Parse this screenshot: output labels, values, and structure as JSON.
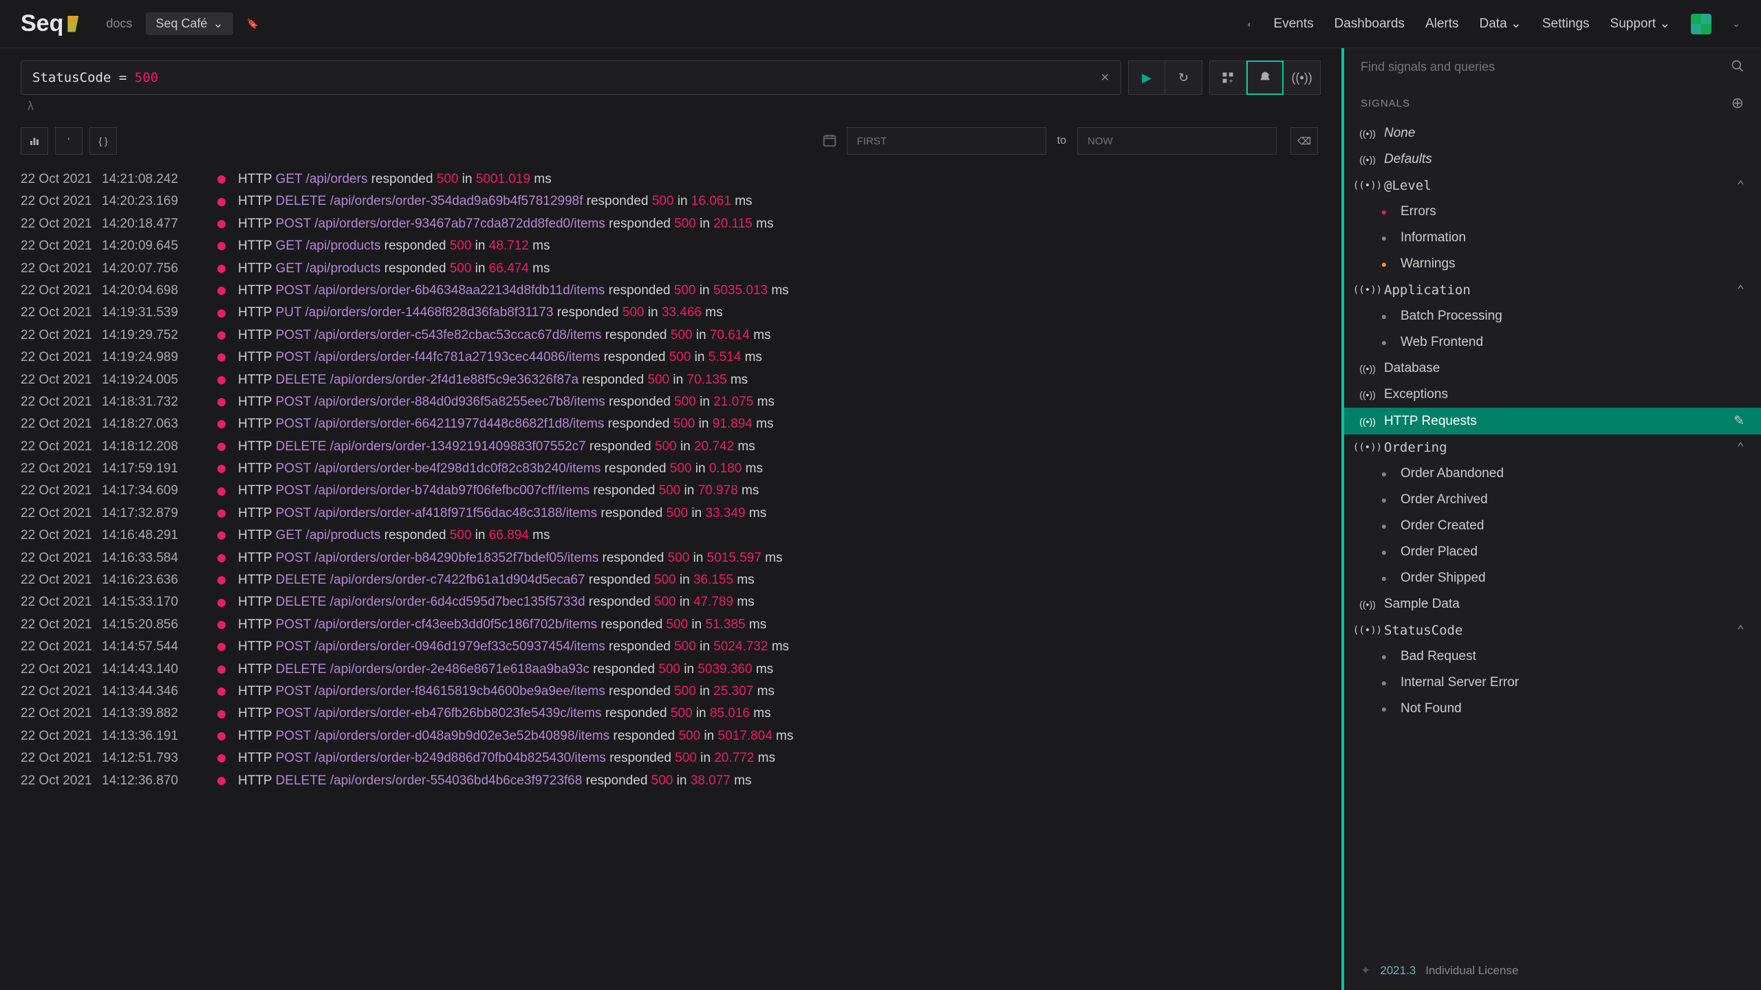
{
  "navbar": {
    "logo": "Seq",
    "docs": "docs",
    "workspace": "Seq Café",
    "right": [
      "Events",
      "Dashboards",
      "Alerts",
      "Data",
      "Settings",
      "Support"
    ]
  },
  "search": {
    "query_field": "StatusCode",
    "query_op": "=",
    "query_val": "500",
    "lambda": "λ"
  },
  "toolbar": {
    "from_placeholder": "FIRST",
    "to_label": "to",
    "to_placeholder": "NOW"
  },
  "sidebar": {
    "search_placeholder": "Find signals and queries",
    "header": "SIGNALS",
    "items": [
      {
        "type": "signal",
        "label": "None",
        "italic": true
      },
      {
        "type": "signal",
        "label": "Defaults",
        "italic": true
      },
      {
        "type": "signal",
        "label": "@Level",
        "mono": true,
        "expandable": true
      },
      {
        "type": "sub",
        "label": "Errors",
        "dot": "err"
      },
      {
        "type": "sub",
        "label": "Information",
        "dot": "info"
      },
      {
        "type": "sub",
        "label": "Warnings",
        "dot": "warn"
      },
      {
        "type": "signal",
        "label": "Application",
        "mono": true,
        "expandable": true
      },
      {
        "type": "sub",
        "label": "Batch Processing",
        "dot": "info"
      },
      {
        "type": "sub",
        "label": "Web Frontend",
        "dot": "info"
      },
      {
        "type": "signal",
        "label": "Database"
      },
      {
        "type": "signal",
        "label": "Exceptions"
      },
      {
        "type": "signal",
        "label": "HTTP Requests",
        "selected": true
      },
      {
        "type": "signal",
        "label": "Ordering",
        "mono": true,
        "expandable": true
      },
      {
        "type": "sub",
        "label": "Order Abandoned",
        "dot": "info"
      },
      {
        "type": "sub",
        "label": "Order Archived",
        "dot": "info"
      },
      {
        "type": "sub",
        "label": "Order Created",
        "dot": "info"
      },
      {
        "type": "sub",
        "label": "Order Placed",
        "dot": "info"
      },
      {
        "type": "sub",
        "label": "Order Shipped",
        "dot": "info"
      },
      {
        "type": "signal",
        "label": "Sample Data"
      },
      {
        "type": "signal",
        "label": "StatusCode",
        "mono": true,
        "expandable": true
      },
      {
        "type": "sub",
        "label": "Bad Request",
        "dot": "info"
      },
      {
        "type": "sub",
        "label": "Internal Server Error",
        "dot": "info"
      },
      {
        "type": "sub",
        "label": "Not Found",
        "dot": "info"
      }
    ],
    "footer": {
      "version": "2021.3",
      "license": "Individual License"
    }
  },
  "events": [
    {
      "date": "22 Oct 2021",
      "time": "14:21:08.242",
      "method": "GET",
      "path": "/api/orders",
      "code": "500",
      "dur": "5001.019"
    },
    {
      "date": "22 Oct 2021",
      "time": "14:20:23.169",
      "method": "DELETE",
      "path": "/api/orders/order-354dad9a69b4f57812998f",
      "code": "500",
      "dur": "16.061"
    },
    {
      "date": "22 Oct 2021",
      "time": "14:20:18.477",
      "method": "POST",
      "path": "/api/orders/order-93467ab77cda872dd8fed0/items",
      "code": "500",
      "dur": "20.115"
    },
    {
      "date": "22 Oct 2021",
      "time": "14:20:09.645",
      "method": "GET",
      "path": "/api/products",
      "code": "500",
      "dur": "48.712"
    },
    {
      "date": "22 Oct 2021",
      "time": "14:20:07.756",
      "method": "GET",
      "path": "/api/products",
      "code": "500",
      "dur": "66.474"
    },
    {
      "date": "22 Oct 2021",
      "time": "14:20:04.698",
      "method": "POST",
      "path": "/api/orders/order-6b46348aa22134d8fdb11d/items",
      "code": "500",
      "dur": "5035.013"
    },
    {
      "date": "22 Oct 2021",
      "time": "14:19:31.539",
      "method": "PUT",
      "path": "/api/orders/order-14468f828d36fab8f31173",
      "code": "500",
      "dur": "33.466"
    },
    {
      "date": "22 Oct 2021",
      "time": "14:19:29.752",
      "method": "POST",
      "path": "/api/orders/order-c543fe82cbac53ccac67d8/items",
      "code": "500",
      "dur": "70.614"
    },
    {
      "date": "22 Oct 2021",
      "time": "14:19:24.989",
      "method": "POST",
      "path": "/api/orders/order-f44fc781a27193cec44086/items",
      "code": "500",
      "dur": "5.514"
    },
    {
      "date": "22 Oct 2021",
      "time": "14:19:24.005",
      "method": "DELETE",
      "path": "/api/orders/order-2f4d1e88f5c9e36326f87a",
      "code": "500",
      "dur": "70.135"
    },
    {
      "date": "22 Oct 2021",
      "time": "14:18:31.732",
      "method": "POST",
      "path": "/api/orders/order-884d0d936f5a8255eec7b8/items",
      "code": "500",
      "dur": "21.075"
    },
    {
      "date": "22 Oct 2021",
      "time": "14:18:27.063",
      "method": "POST",
      "path": "/api/orders/order-664211977d448c8682f1d8/items",
      "code": "500",
      "dur": "91.894"
    },
    {
      "date": "22 Oct 2021",
      "time": "14:18:12.208",
      "method": "DELETE",
      "path": "/api/orders/order-13492191409883f07552c7",
      "code": "500",
      "dur": "20.742"
    },
    {
      "date": "22 Oct 2021",
      "time": "14:17:59.191",
      "method": "POST",
      "path": "/api/orders/order-be4f298d1dc0f82c83b240/items",
      "code": "500",
      "dur": "0.180"
    },
    {
      "date": "22 Oct 2021",
      "time": "14:17:34.609",
      "method": "POST",
      "path": "/api/orders/order-b74dab97f06fefbc007cff/items",
      "code": "500",
      "dur": "70.978"
    },
    {
      "date": "22 Oct 2021",
      "time": "14:17:32.879",
      "method": "POST",
      "path": "/api/orders/order-af418f971f56dac48c3188/items",
      "code": "500",
      "dur": "33.349"
    },
    {
      "date": "22 Oct 2021",
      "time": "14:16:48.291",
      "method": "GET",
      "path": "/api/products",
      "code": "500",
      "dur": "66.894"
    },
    {
      "date": "22 Oct 2021",
      "time": "14:16:33.584",
      "method": "POST",
      "path": "/api/orders/order-b84290bfe18352f7bdef05/items",
      "code": "500",
      "dur": "5015.597"
    },
    {
      "date": "22 Oct 2021",
      "time": "14:16:23.636",
      "method": "DELETE",
      "path": "/api/orders/order-c7422fb61a1d904d5eca67",
      "code": "500",
      "dur": "36.155"
    },
    {
      "date": "22 Oct 2021",
      "time": "14:15:33.170",
      "method": "DELETE",
      "path": "/api/orders/order-6d4cd595d7bec135f5733d",
      "code": "500",
      "dur": "47.789"
    },
    {
      "date": "22 Oct 2021",
      "time": "14:15:20.856",
      "method": "POST",
      "path": "/api/orders/order-cf43eeb3dd0f5c186f702b/items",
      "code": "500",
      "dur": "51.385"
    },
    {
      "date": "22 Oct 2021",
      "time": "14:14:57.544",
      "method": "POST",
      "path": "/api/orders/order-0946d1979ef33c50937454/items",
      "code": "500",
      "dur": "5024.732"
    },
    {
      "date": "22 Oct 2021",
      "time": "14:14:43.140",
      "method": "DELETE",
      "path": "/api/orders/order-2e486e8671e618aa9ba93c",
      "code": "500",
      "dur": "5039.360"
    },
    {
      "date": "22 Oct 2021",
      "time": "14:13:44.346",
      "method": "POST",
      "path": "/api/orders/order-f84615819cb4600be9a9ee/items",
      "code": "500",
      "dur": "25.307"
    },
    {
      "date": "22 Oct 2021",
      "time": "14:13:39.882",
      "method": "POST",
      "path": "/api/orders/order-eb476fb26bb8023fe5439c/items",
      "code": "500",
      "dur": "85.016"
    },
    {
      "date": "22 Oct 2021",
      "time": "14:13:36.191",
      "method": "POST",
      "path": "/api/orders/order-d048a9b9d02e3e52b40898/items",
      "code": "500",
      "dur": "5017.804"
    },
    {
      "date": "22 Oct 2021",
      "time": "14:12:51.793",
      "method": "POST",
      "path": "/api/orders/order-b249d886d70fb04b825430/items",
      "code": "500",
      "dur": "20.772"
    },
    {
      "date": "22 Oct 2021",
      "time": "14:12:36.870",
      "method": "DELETE",
      "path": "/api/orders/order-554036bd4b6ce3f9723f68",
      "code": "500",
      "dur": "38.077"
    }
  ]
}
